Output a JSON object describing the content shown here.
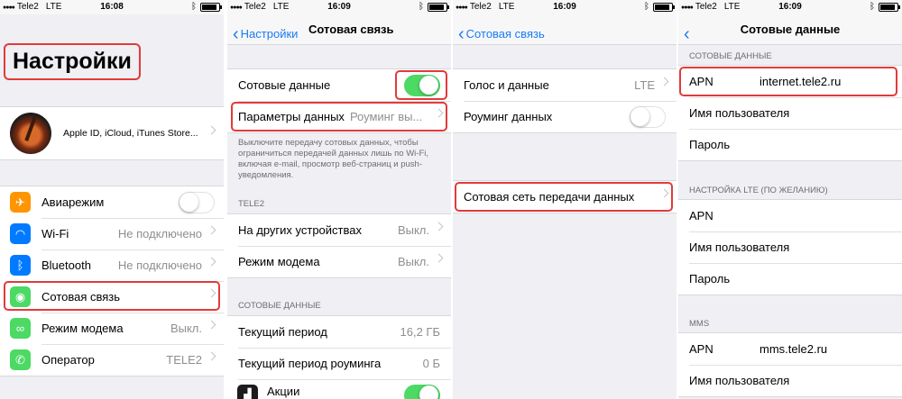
{
  "status": {
    "carrier": "Tele2",
    "network": "LTE",
    "times": [
      "16:08",
      "16:09",
      "16:09",
      "16:09"
    ]
  },
  "panel1": {
    "title": "Настройки",
    "profile_text": "Apple ID, iCloud, iTunes Store...",
    "items": [
      {
        "label": "Авиарежим",
        "icon": "airplane-icon",
        "color": "#ff9500",
        "glyph": "✈"
      },
      {
        "label": "Wi-Fi",
        "value": "Не подключено",
        "icon": "wifi-icon",
        "color": "#007aff",
        "glyph": "◠"
      },
      {
        "label": "Bluetooth",
        "value": "Не подключено",
        "icon": "bluetooth-icon",
        "color": "#007aff",
        "glyph": "ᛒ"
      },
      {
        "label": "Сотовая связь",
        "icon": "cellular-icon",
        "color": "#4cd964",
        "glyph": "◉"
      },
      {
        "label": "Режим модема",
        "value": "Выкл.",
        "icon": "hotspot-icon",
        "color": "#4cd964",
        "glyph": "∞"
      },
      {
        "label": "Оператор",
        "value": "TELE2",
        "icon": "phone-icon",
        "color": "#4cd964",
        "glyph": "✆"
      }
    ]
  },
  "panel2": {
    "back": "Настройки",
    "title": "Сотовая связь",
    "cellular_data": "Сотовые данные",
    "data_options": "Параметры данных",
    "data_options_value": "Роуминг вы...",
    "note": "Выключите передачу сотовых данных, чтобы ограничиться передачей данных лишь по Wi-Fi, включая e-mail, просмотр веб-страниц и push-уведомления.",
    "tele2_header": "TELE2",
    "other_devices": "На других устройствах",
    "other_devices_value": "Выкл.",
    "modem": "Режим модема",
    "modem_value": "Выкл.",
    "cell_data_header": "СОТОВЫЕ ДАННЫЕ",
    "current_period": "Текущий период",
    "current_period_value": "16,2 ГБ",
    "roaming_period": "Текущий период роуминга",
    "roaming_period_value": "0 Б",
    "stocks": "Акции"
  },
  "panel3": {
    "back": "Сотовая связь",
    "voice_data": "Голос и данные",
    "voice_data_value": "LTE",
    "data_roaming": "Роуминг данных",
    "cellular_network": "Сотовая сеть передачи данных"
  },
  "panel4": {
    "title": "Сотовые данные",
    "header1": "СОТОВЫЕ ДАННЫЕ",
    "apn_label": "APN",
    "apn_value": "internet.tele2.ru",
    "username": "Имя пользователя",
    "password": "Пароль",
    "header2": "НАСТРОЙКА LTE (ПО ЖЕЛАНИЮ)",
    "lte_apn": "APN",
    "lte_username": "Имя пользователя",
    "lte_password": "Пароль",
    "header3": "MMS",
    "mms_apn_label": "APN",
    "mms_apn_value": "mms.tele2.ru",
    "mms_username": "Имя пользователя"
  }
}
